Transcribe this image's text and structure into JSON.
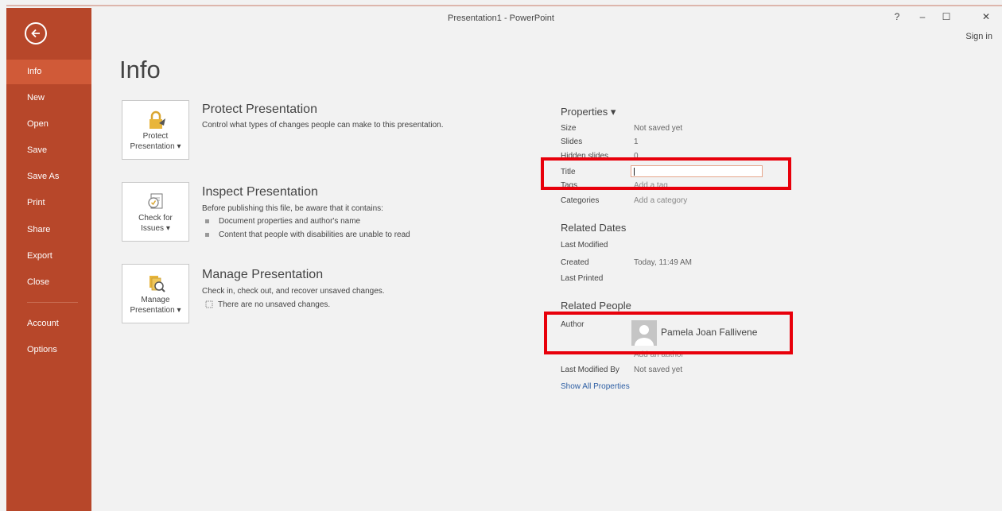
{
  "window": {
    "title": "Presentation1 - PowerPoint",
    "help": "?",
    "minimize": "–",
    "maximize": "☐",
    "close": "✕",
    "signin": "Sign in"
  },
  "sidebar": {
    "items": [
      "Info",
      "New",
      "Open",
      "Save",
      "Save As",
      "Print",
      "Share",
      "Export",
      "Close",
      "Account",
      "Options"
    ]
  },
  "page": {
    "title": "Info"
  },
  "protect": {
    "btn1": "Protect",
    "btn2": "Presentation ▾",
    "title": "Protect Presentation",
    "desc": "Control what types of changes people can make to this presentation."
  },
  "inspect": {
    "btn1": "Check for",
    "btn2": "Issues ▾",
    "title": "Inspect Presentation",
    "desc": "Before publishing this file, be aware that it contains:",
    "bullets": [
      "Document properties and author's name",
      "Content that people with disabilities are unable to read"
    ]
  },
  "manage": {
    "btn1": "Manage",
    "btn2": "Presentation ▾",
    "title": "Manage Presentation",
    "desc": "Check in, check out, and recover unsaved changes.",
    "note": "There are no unsaved changes."
  },
  "properties": {
    "heading": "Properties ▾",
    "size_label": "Size",
    "size_value": "Not saved yet",
    "slides_label": "Slides",
    "slides_value": "1",
    "hidden_label": "Hidden slides",
    "hidden_value": "0",
    "title_label": "Title",
    "title_value": "",
    "tags_label": "Tags",
    "tags_value": "Add a tag",
    "categories_label": "Categories",
    "categories_value": "Add a category"
  },
  "dates": {
    "heading": "Related Dates",
    "last_modified": "Last Modified",
    "created_label": "Created",
    "created_value": "Today, 11:49 AM",
    "last_printed": "Last Printed"
  },
  "people": {
    "heading": "Related People",
    "author_label": "Author",
    "author_name": "Pamela Joan Fallivene",
    "add_author": "Add an author",
    "modified_by_label": "Last Modified By",
    "modified_by_value": "Not saved yet",
    "show_all": "Show All Properties"
  },
  "colors": {
    "accent": "#b7472a",
    "active": "#d05a38",
    "highlight": "#e8000b",
    "link": "#2e5fa4"
  }
}
